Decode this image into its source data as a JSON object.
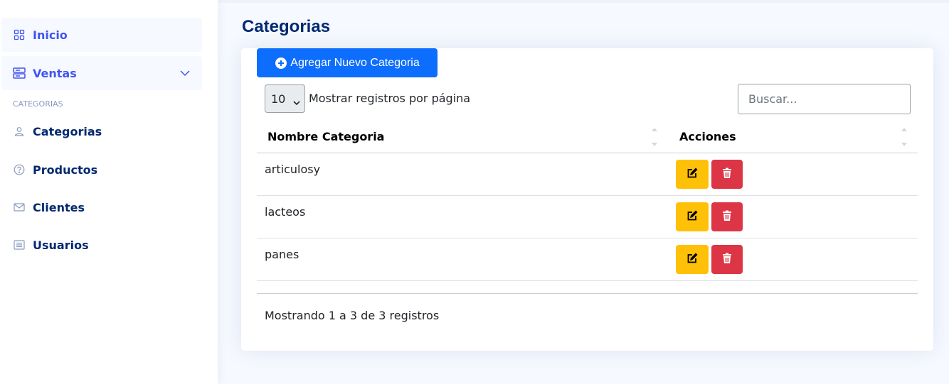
{
  "sidebar": {
    "items": [
      {
        "label": "Inicio",
        "icon": "grid-icon"
      },
      {
        "label": "Ventas",
        "icon": "server-icon"
      }
    ],
    "heading": "CATEGORIAS",
    "subitems": [
      {
        "label": "Categorias",
        "icon": "person-icon"
      },
      {
        "label": "Productos",
        "icon": "question-circle-icon"
      },
      {
        "label": "Clientes",
        "icon": "envelope-icon"
      },
      {
        "label": "Usuarios",
        "icon": "list-icon"
      }
    ]
  },
  "page": {
    "title": "Categorias",
    "add_button": "Agregar Nuevo Categoria"
  },
  "table_controls": {
    "length_value": "10",
    "length_label": "Mostrar registros por página",
    "search_placeholder": "Buscar..."
  },
  "table": {
    "columns": [
      "Nombre Categoria",
      "Acciones"
    ],
    "rows": [
      {
        "name": "articulosy"
      },
      {
        "name": "lacteos"
      },
      {
        "name": "panes"
      }
    ],
    "info": "Mostrando 1 a 3 de 3 registros"
  },
  "colors": {
    "primary": "#0d6efd",
    "sidebar_accent": "#4154f1",
    "title": "#012970",
    "edit": "#ffc107",
    "delete": "#dc3545"
  }
}
